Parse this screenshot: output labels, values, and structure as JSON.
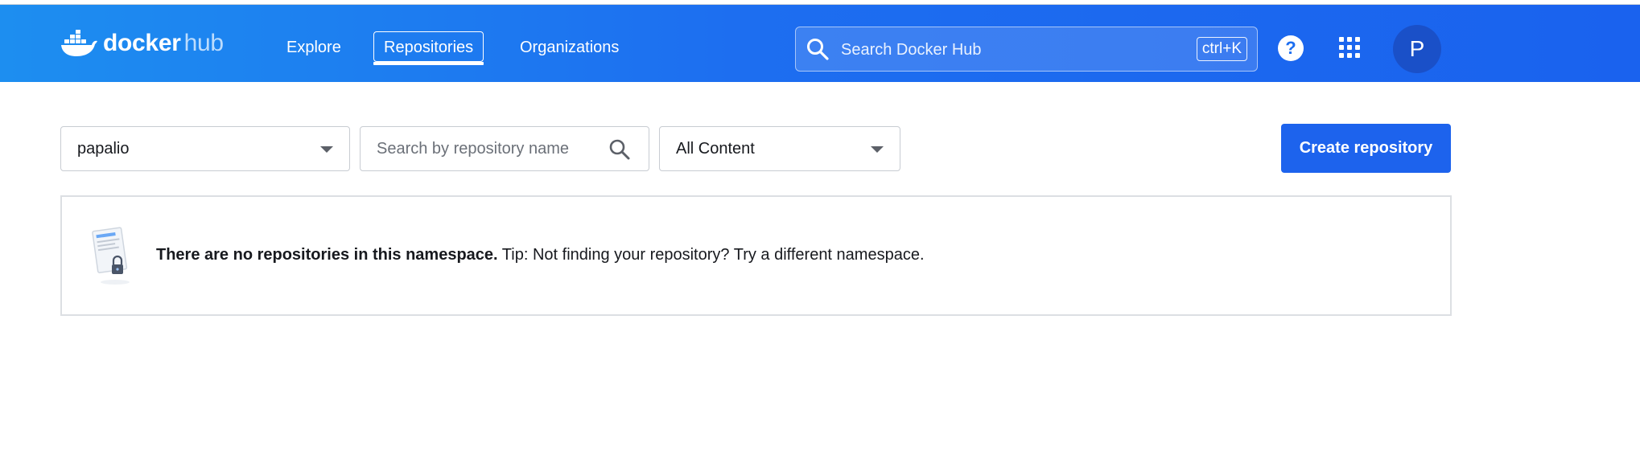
{
  "header": {
    "logo_primary": "docker",
    "logo_secondary": "hub",
    "nav": {
      "explore": "Explore",
      "repositories": "Repositories",
      "organizations": "Organizations"
    },
    "search": {
      "placeholder": "Search Docker Hub",
      "shortcut": "ctrl+K"
    },
    "help_icon": "?",
    "apps_icon": "grid-icon",
    "avatar_initial": "P"
  },
  "toolbar": {
    "namespace": "papalio",
    "repo_search_placeholder": "Search by repository name",
    "content_filter": "All Content",
    "create_button": "Create repository"
  },
  "empty_state": {
    "title": "There are no repositories in this namespace.",
    "tip": "Tip: Not finding your repository? Try a different namespace."
  },
  "colors": {
    "header_gradient_start": "#1d8ef0",
    "header_gradient_end": "#1a62ee",
    "primary_button": "#1d63ed",
    "avatar": "#1a50c8"
  }
}
